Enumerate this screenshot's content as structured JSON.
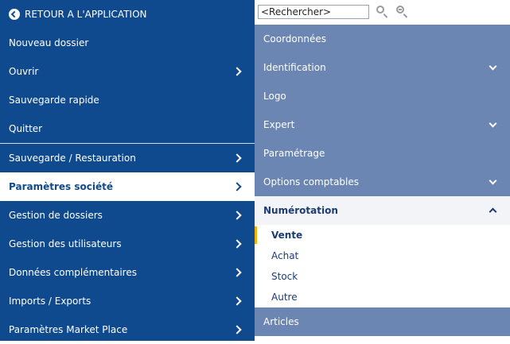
{
  "left_menu": {
    "back_label": "RETOUR A L'APPLICATION",
    "items": [
      {
        "label": "Nouveau dossier"
      },
      {
        "label": "Ouvrir"
      },
      {
        "label": "Sauvegarde rapide"
      },
      {
        "label": "Quitter"
      },
      {
        "label": "Sauvegarde / Restauration"
      },
      {
        "label": "Paramètres société"
      },
      {
        "label": "Gestion de dossiers"
      },
      {
        "label": "Gestion des utilisateurs"
      },
      {
        "label": "Données complémentaires"
      },
      {
        "label": "Imports / Exports"
      },
      {
        "label": "Paramètres Market Place"
      }
    ]
  },
  "search": {
    "value": "<Rechercher>"
  },
  "right_menu": {
    "items": [
      {
        "label": "Coordonnées"
      },
      {
        "label": "Identification"
      },
      {
        "label": "Logo"
      },
      {
        "label": "Expert"
      },
      {
        "label": "Paramétrage"
      },
      {
        "label": "Options comptables"
      },
      {
        "label": "Numérotation"
      },
      {
        "label": "Articles"
      }
    ],
    "numerotation_sub": [
      {
        "label": "Vente"
      },
      {
        "label": "Achat"
      },
      {
        "label": "Stock"
      },
      {
        "label": "Autre"
      }
    ]
  },
  "colors": {
    "left_bg": "#0f4a8f",
    "right_item_bg": "#6b86b3",
    "active_accent": "#f2b400"
  }
}
